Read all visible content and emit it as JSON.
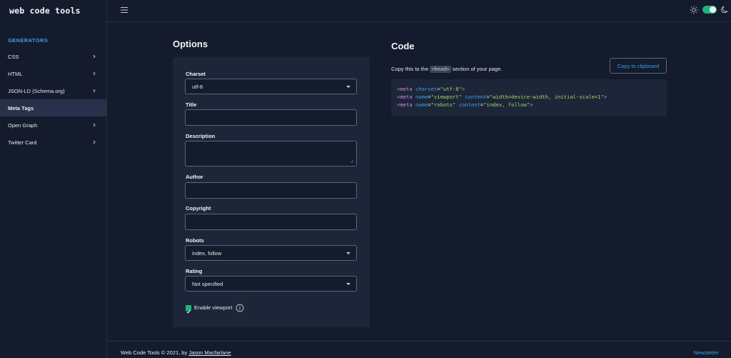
{
  "app": {
    "logo": "web code tools"
  },
  "sidebar": {
    "heading": "GENERATORS",
    "items": [
      {
        "label": "CSS",
        "has_chevron": true
      },
      {
        "label": "HTML",
        "has_chevron": true
      },
      {
        "label": "JSON-LD (Schema.org)",
        "has_chevron": true
      },
      {
        "label": "Meta Tags",
        "has_chevron": false,
        "active": true
      },
      {
        "label": "Open Graph",
        "has_chevron": true
      },
      {
        "label": "Twitter Card",
        "has_chevron": true
      }
    ]
  },
  "topbar": {
    "menu_icon": "hamburger-icon",
    "theme_toggle": {
      "on": true,
      "left_icon": "sun-icon",
      "right_icon": "moon-icon"
    }
  },
  "options": {
    "title": "Options",
    "charset": {
      "label": "Charset",
      "value": "utf-8"
    },
    "title_field": {
      "label": "Title",
      "value": ""
    },
    "description": {
      "label": "Description",
      "value": ""
    },
    "author": {
      "label": "Author",
      "value": ""
    },
    "copyright": {
      "label": "Copyright",
      "value": ""
    },
    "robots": {
      "label": "Robots",
      "value": "index, follow"
    },
    "rating": {
      "label": "Rating",
      "value": "Not specified"
    },
    "viewport": {
      "label": "Enable viewport",
      "checked": true
    }
  },
  "code": {
    "title": "Code",
    "copy_button": "Copy to clipboard",
    "desc_before": "Copy this to the",
    "desc_tag": "<head>",
    "desc_after": "section of your page.",
    "lines": [
      {
        "tag": "<meta",
        "attrs": [
          {
            "name": "charset",
            "value": "\"utf-8\""
          }
        ],
        "close": ">"
      },
      {
        "tag": "<meta",
        "attrs": [
          {
            "name": "name",
            "value": "\"viewport\""
          },
          {
            "name": "content",
            "value": "\"width=device-width, initial-scale=1\""
          }
        ],
        "close": ">"
      },
      {
        "tag": "<meta",
        "attrs": [
          {
            "name": "name",
            "value": "\"robots\""
          },
          {
            "name": "content",
            "value": "\"index, follow\""
          }
        ],
        "close": ">"
      }
    ]
  },
  "footer": {
    "text": "Web Code Tools © 2021, by",
    "author_link": "Jason Macfarlane",
    "newsletter": "Newsletter"
  },
  "colors": {
    "background": "#131b2c",
    "panel": "#1c2638",
    "accent_blue": "#3ba1e6",
    "accent_green": "#1fb37d",
    "code_tag": "#d781e8",
    "code_value": "#a7d56a"
  }
}
